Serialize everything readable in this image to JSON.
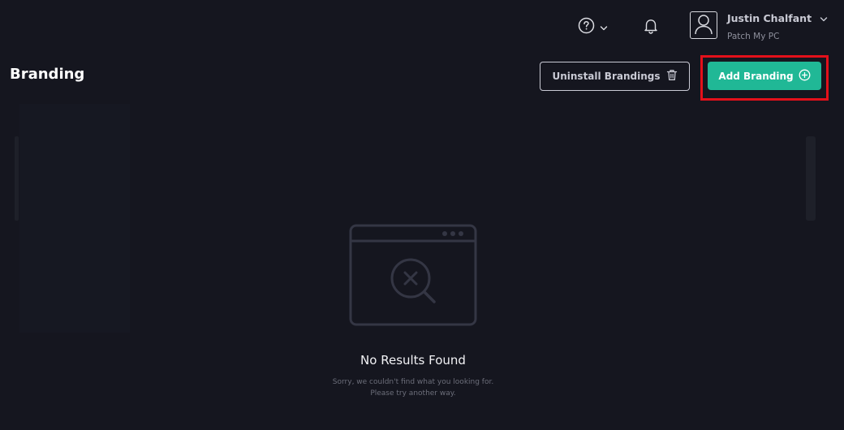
{
  "topbar": {
    "help_icon": "help-circle-icon",
    "notifications_icon": "bell-icon",
    "user": {
      "name": "Justin Chalfant",
      "organization": "Patch My PC",
      "avatar_icon": "user-icon"
    }
  },
  "header": {
    "title": "Branding",
    "uninstall_label": "Uninstall Brandings",
    "uninstall_icon": "trash-icon",
    "add_label": "Add Branding",
    "add_icon": "plus-circle-icon",
    "highlight_color": "#e3101a"
  },
  "empty_state": {
    "illustration_icon": "browser-search-x-icon",
    "title": "No Results Found",
    "message": "Sorry, we couldn't find what you looking for. Please try another way."
  },
  "colors": {
    "background": "#15161f",
    "accent": "#20b896",
    "text_muted": "#8e909c"
  }
}
